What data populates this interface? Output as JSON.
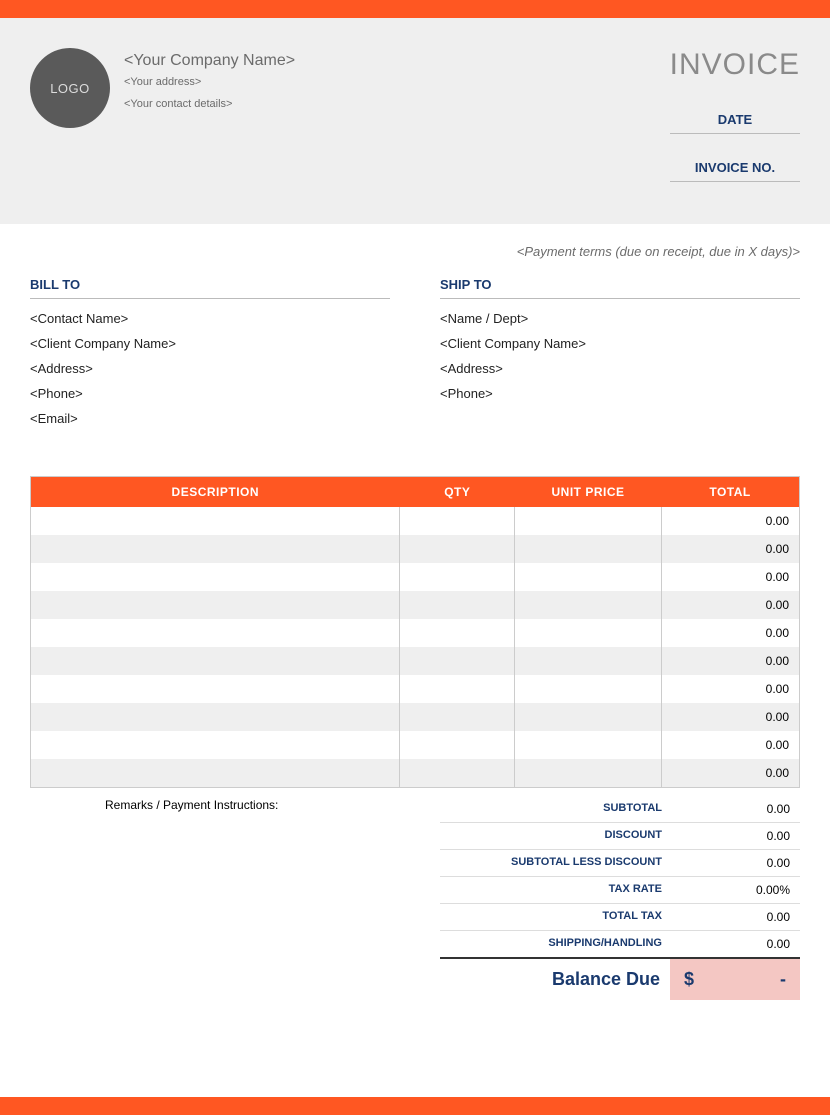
{
  "header": {
    "logo_text": "LOGO",
    "company_name": "<Your Company Name>",
    "address": "<Your address>",
    "contact": "<Your contact details>",
    "title": "INVOICE",
    "date_label": "DATE",
    "invoice_no_label": "INVOICE NO."
  },
  "payment_terms": "<Payment terms (due on receipt, due in X days)>",
  "bill_to": {
    "heading": "BILL TO",
    "lines": [
      "<Contact Name>",
      "<Client Company Name>",
      "<Address>",
      "<Phone>",
      "<Email>"
    ]
  },
  "ship_to": {
    "heading": "SHIP TO",
    "lines": [
      "<Name / Dept>",
      "<Client Company Name>",
      "<Address>",
      "<Phone>"
    ]
  },
  "table": {
    "headers": [
      "DESCRIPTION",
      "QTY",
      "UNIT PRICE",
      "TOTAL"
    ],
    "rows": [
      {
        "desc": "",
        "qty": "",
        "unit": "",
        "total": "0.00"
      },
      {
        "desc": "",
        "qty": "",
        "unit": "",
        "total": "0.00"
      },
      {
        "desc": "",
        "qty": "",
        "unit": "",
        "total": "0.00"
      },
      {
        "desc": "",
        "qty": "",
        "unit": "",
        "total": "0.00"
      },
      {
        "desc": "",
        "qty": "",
        "unit": "",
        "total": "0.00"
      },
      {
        "desc": "",
        "qty": "",
        "unit": "",
        "total": "0.00"
      },
      {
        "desc": "",
        "qty": "",
        "unit": "",
        "total": "0.00"
      },
      {
        "desc": "",
        "qty": "",
        "unit": "",
        "total": "0.00"
      },
      {
        "desc": "",
        "qty": "",
        "unit": "",
        "total": "0.00"
      },
      {
        "desc": "",
        "qty": "",
        "unit": "",
        "total": "0.00"
      }
    ]
  },
  "remarks_label": "Remarks / Payment Instructions:",
  "totals": {
    "rows": [
      {
        "label": "SUBTOTAL",
        "value": "0.00"
      },
      {
        "label": "DISCOUNT",
        "value": "0.00"
      },
      {
        "label": "SUBTOTAL LESS DISCOUNT",
        "value": "0.00"
      },
      {
        "label": "TAX RATE",
        "value": "0.00%"
      },
      {
        "label": "TOTAL TAX",
        "value": "0.00"
      },
      {
        "label": "SHIPPING/HANDLING",
        "value": "0.00"
      }
    ],
    "balance_label": "Balance Due",
    "balance_currency": "$",
    "balance_value": "-"
  }
}
